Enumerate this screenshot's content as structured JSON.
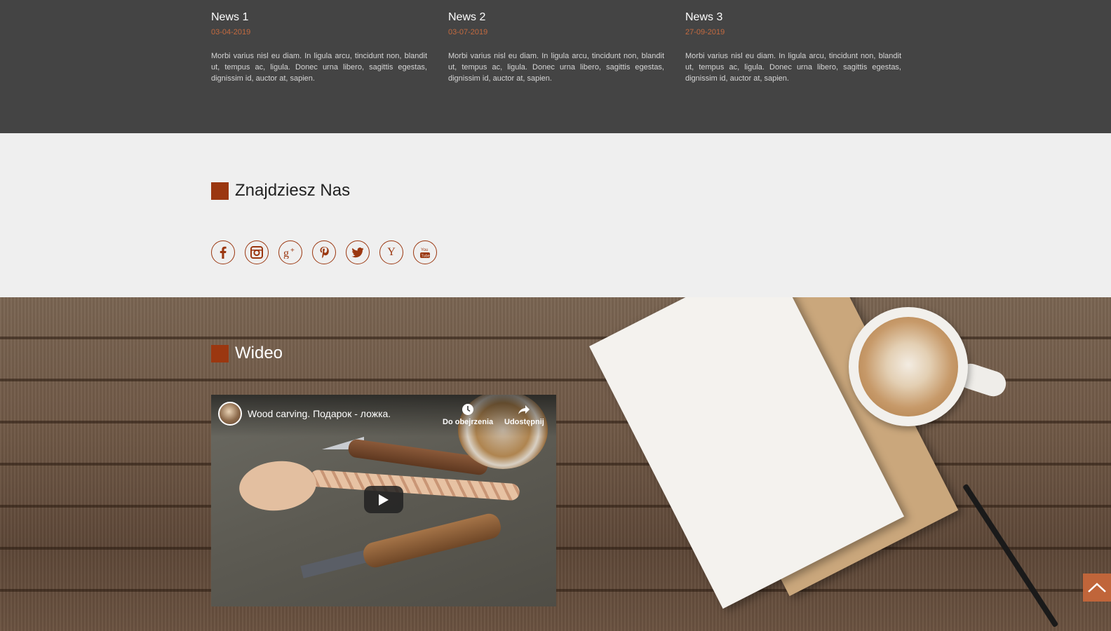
{
  "news": [
    {
      "title": "News 1",
      "date": "03-04-2019",
      "text": "Morbi varius nisl eu diam. In ligula arcu, tincidunt non, blandit ut, tempus ac, ligula. Donec urna libero, sagittis egestas, dignissim id, auctor at, sapien."
    },
    {
      "title": "News 2",
      "date": "03-07-2019",
      "text": "Morbi varius nisl eu diam. In ligula arcu, tincidunt non, blandit ut, tempus ac, ligula. Donec urna libero, sagittis egestas, dignissim id, auctor at, sapien."
    },
    {
      "title": "News 3",
      "date": "27-09-2019",
      "text": "Morbi varius nisl eu diam. In ligula arcu, tincidunt non, blandit ut, tempus ac, ligula. Donec urna libero, sagittis egestas, dignissim id, auctor at, sapien."
    }
  ],
  "find_us": {
    "heading": "Znajdziesz Nas",
    "social": [
      {
        "name": "facebook-icon"
      },
      {
        "name": "instagram-icon"
      },
      {
        "name": "google-plus-icon"
      },
      {
        "name": "pinterest-icon"
      },
      {
        "name": "twitter-icon"
      },
      {
        "name": "yelp-icon"
      },
      {
        "name": "youtube-icon"
      }
    ]
  },
  "video": {
    "heading": "Wideo",
    "title": "Wood carving. Подарок - ложка.",
    "watch_later": "Do obejrzenia",
    "share": "Udostępnij"
  },
  "colors": {
    "accent": "#9b3710",
    "news_bg": "#444444",
    "date": "#c46a3f",
    "light_bg": "#efefef",
    "scroll_top": "#c0653a"
  }
}
